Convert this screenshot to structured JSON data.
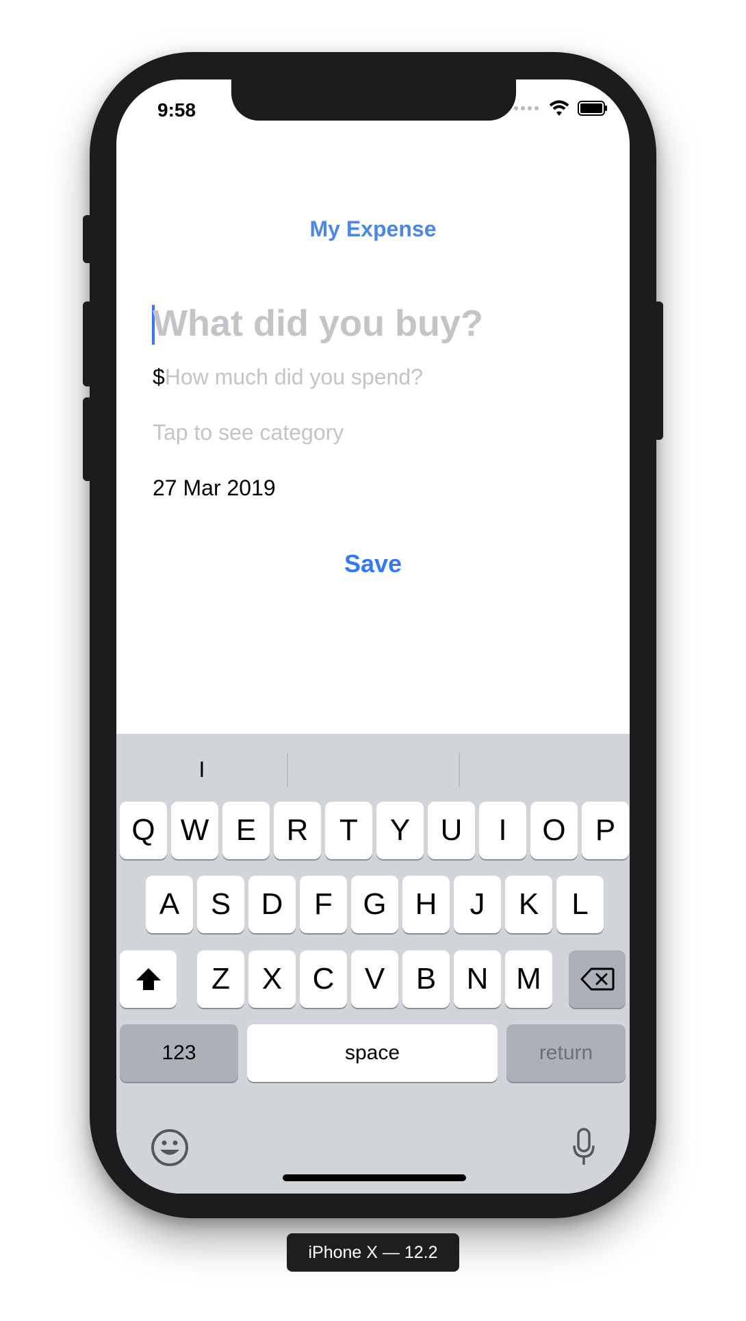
{
  "status_bar": {
    "time": "9:58"
  },
  "app": {
    "title": "My Expense",
    "item_placeholder": "What did you buy?",
    "currency_symbol": "$",
    "amount_placeholder": "How much did you spend?",
    "category_placeholder": "Tap to see category",
    "date": "27 Mar 2019",
    "save_label": "Save",
    "accent_color": "#3478f6",
    "placeholder_color": "#c4c4c8"
  },
  "keyboard": {
    "suggestions": [
      "I",
      "",
      ""
    ],
    "row1": [
      "Q",
      "W",
      "E",
      "R",
      "T",
      "Y",
      "U",
      "I",
      "O",
      "P"
    ],
    "row2": [
      "A",
      "S",
      "D",
      "F",
      "G",
      "H",
      "J",
      "K",
      "L"
    ],
    "row3": [
      "Z",
      "X",
      "C",
      "V",
      "B",
      "N",
      "M"
    ],
    "numbers_label": "123",
    "space_label": "space",
    "return_label": "return",
    "shift_icon": "shift-icon",
    "delete_icon": "delete-icon",
    "emoji_icon": "emoji-icon",
    "mic_icon": "microphone-icon"
  },
  "simulator_label": "iPhone X — 12.2"
}
